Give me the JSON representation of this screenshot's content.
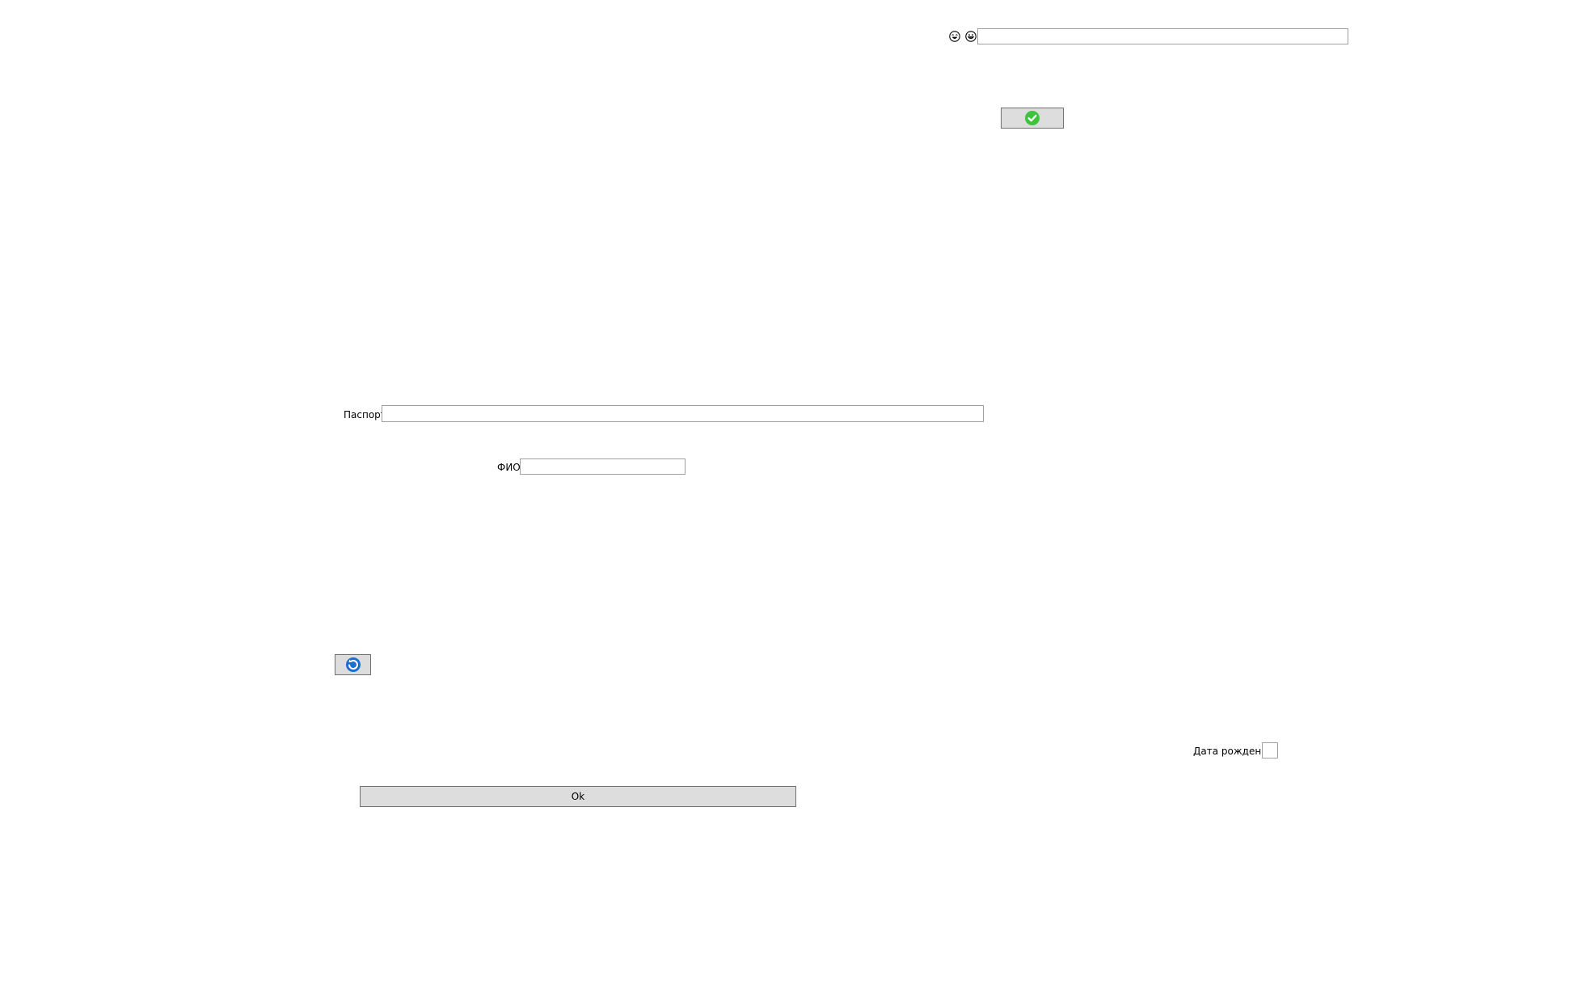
{
  "top": {
    "emoji_1": "laughing-emoji-icon",
    "emoji_2": "grinning-emoji-icon",
    "input_value": "",
    "confirm_icon": "green-check-icon"
  },
  "form": {
    "passport_label": "Паспорт",
    "passport_value": "",
    "fio_label": "ФИО",
    "fio_value": "",
    "refresh_icon": "blue-refresh-icon",
    "birthdate_label": "Дата рождения",
    "ok_label": "Ok"
  },
  "colors": {
    "check_green": "#3cc43c",
    "refresh_blue": "#1a6fd1",
    "button_bg": "#dddddd"
  }
}
